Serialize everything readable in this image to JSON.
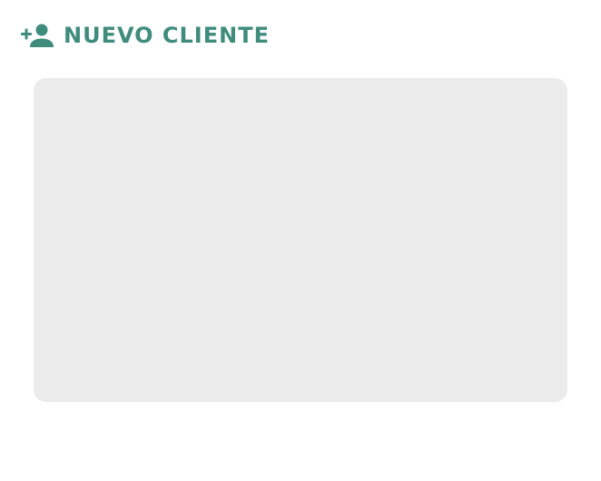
{
  "header": {
    "icon": "add-person-icon",
    "title": "NUEVO CLIENTE"
  },
  "colors": {
    "accent": "#3f8c7c",
    "panel_background": "#ebebeb",
    "page_background": "#ffffff"
  }
}
